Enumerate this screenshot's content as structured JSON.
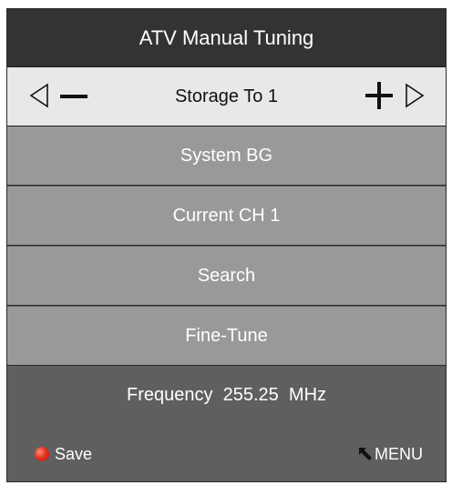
{
  "title": "ATV Manual Tuning",
  "storage": {
    "label": "Storage To 1"
  },
  "items": [
    {
      "label": "System BG"
    },
    {
      "label": "Current CH 1"
    },
    {
      "label": "Search"
    },
    {
      "label": "Fine-Tune"
    }
  ],
  "frequency": {
    "label": "Frequency",
    "value": "255.25",
    "unit": "MHz"
  },
  "footer": {
    "save_label": "Save",
    "menu_label": "MENU"
  },
  "icons": {
    "left": "triangle-left-icon",
    "minus": "minus-icon",
    "plus": "plus-icon",
    "right": "triangle-right-icon",
    "save": "red-dot-icon",
    "menu": "return-arrow-icon"
  },
  "colors": {
    "title_bg": "#333333",
    "row_active_bg": "#e8e8e8",
    "item_bg": "#999999",
    "footer_bg": "#5f5f5f",
    "save_dot": "#e63322"
  }
}
